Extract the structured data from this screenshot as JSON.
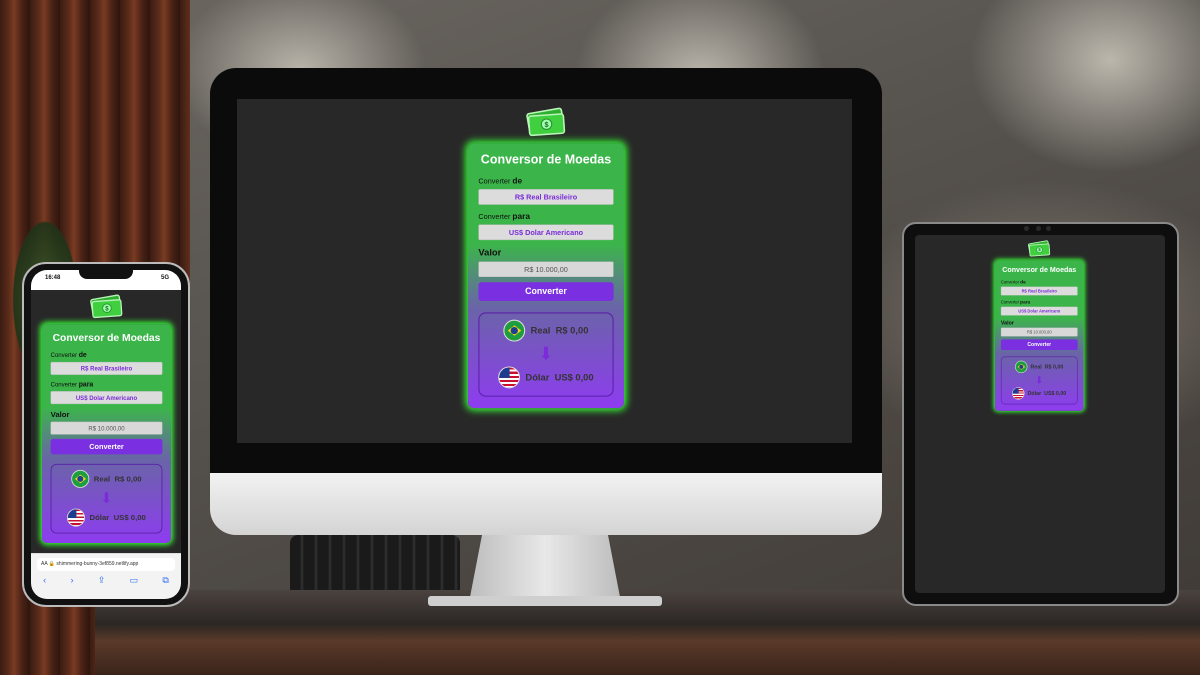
{
  "app": {
    "title": "Conversor de Moedas",
    "from_label_prefix": "Converter ",
    "from_label_bold": "de",
    "from_value": "R$ Real Brasileiro",
    "to_label_prefix": "Converter ",
    "to_label_bold": "para",
    "to_value": "US$ Dolar Americano",
    "amount_label": "Valor",
    "amount_placeholder": "R$ 10.000,00",
    "convert_button": "Converter",
    "result_from_name": "Real",
    "result_from_value": "R$ 0,00",
    "result_to_name": "Dólar",
    "result_to_value": "US$ 0,00"
  },
  "phone": {
    "time": "16:48",
    "signal": "5G",
    "url": "shimmering-bunny-3ef859.netlify.app",
    "aa_label": "AA"
  },
  "icons": {
    "money": "money-bills-icon",
    "arrow": "arrow-down-icon",
    "flag_from": "brazil-flag-icon",
    "flag_to": "usa-flag-icon"
  },
  "colors": {
    "card_green": "#3bb54a",
    "card_purple": "#8e3cf0",
    "button_purple": "#7a2fe0",
    "glow": "#37ff37",
    "screen_bg": "#282828"
  }
}
